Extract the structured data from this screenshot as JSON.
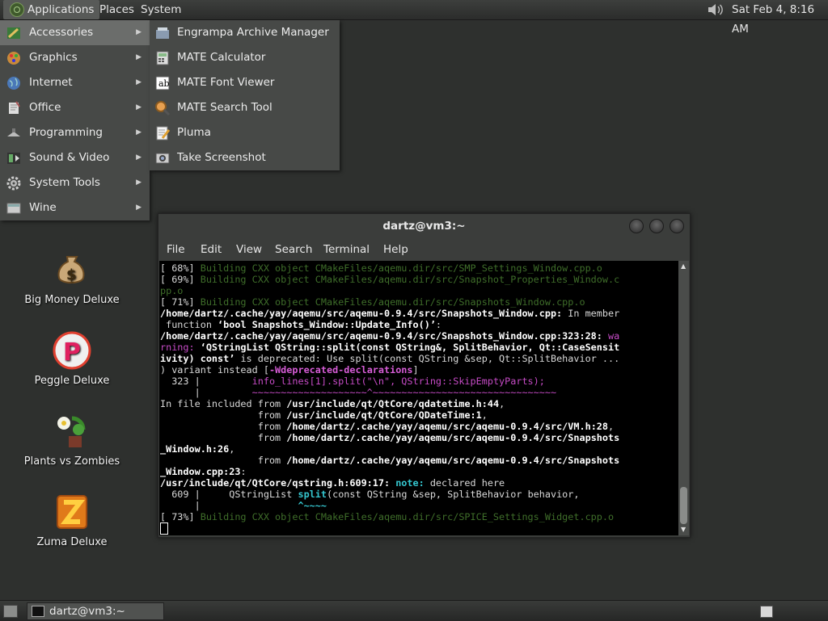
{
  "top_panel": {
    "applications": "Applications",
    "places": "Places",
    "system": "System",
    "volume_icon": "speaker-icon",
    "clock": "Sat Feb  4,  8:16 AM"
  },
  "app_menu": {
    "items": [
      {
        "label": "Accessories",
        "icon": "accessories-icon"
      },
      {
        "label": "Graphics",
        "icon": "graphics-icon"
      },
      {
        "label": "Internet",
        "icon": "globe-icon"
      },
      {
        "label": "Office",
        "icon": "office-icon"
      },
      {
        "label": "Programming",
        "icon": "programming-icon"
      },
      {
        "label": "Sound & Video",
        "icon": "sound-video-icon"
      },
      {
        "label": "System Tools",
        "icon": "gear-icon"
      },
      {
        "label": "Wine",
        "icon": "wine-icon"
      }
    ],
    "submenu": [
      {
        "label": "Engrampa Archive Manager",
        "icon": "archive-icon"
      },
      {
        "label": "MATE Calculator",
        "icon": "calculator-icon"
      },
      {
        "label": "MATE Font Viewer",
        "icon": "font-icon"
      },
      {
        "label": "MATE Search Tool",
        "icon": "search-icon"
      },
      {
        "label": "Pluma",
        "icon": "text-editor-icon"
      },
      {
        "label": "Take Screenshot",
        "icon": "screenshot-icon"
      }
    ]
  },
  "desktop_icons": [
    {
      "label": "Big Money Deluxe",
      "icon": "money-bag-icon"
    },
    {
      "label": "Peggle Deluxe",
      "icon": "peggle-icon"
    },
    {
      "label": "Plants vs Zombies",
      "icon": "plants-icon"
    },
    {
      "label": "Zuma Deluxe",
      "icon": "zuma-icon"
    }
  ],
  "terminal": {
    "title": "dartz@vm3:~",
    "menu": [
      "File",
      "Edit",
      "View",
      "Search",
      "Terminal",
      "Help"
    ],
    "lines": [
      [
        [
          "t",
          "[ 68%] "
        ],
        [
          "g",
          "Building CXX object CMakeFiles/aqemu.dir/src/SMP_Settings_Window.cpp.o"
        ]
      ],
      [
        [
          "t",
          "[ 69%] "
        ],
        [
          "g",
          "Building CXX object CMakeFiles/aqemu.dir/src/Snapshot_Properties_Window.c"
        ]
      ],
      [
        [
          "g",
          "pp.o"
        ]
      ],
      [
        [
          "t",
          "[ 71%] "
        ],
        [
          "g",
          "Building CXX object CMakeFiles/aqemu.dir/src/Snapshots_Window.cpp.o"
        ]
      ],
      [
        [
          "w",
          "/home/dartz/.cache/yay/aqemu/src/aqemu-0.9.4/src/Snapshots_Window.cpp:"
        ],
        [
          "t",
          " In member"
        ]
      ],
      [
        [
          "t",
          " function "
        ],
        [
          "w",
          "‘bool Snapshots_Window::Update_Info()’"
        ],
        [
          "t",
          ":"
        ]
      ],
      [
        [
          "w",
          "/home/dartz/.cache/yay/aqemu/src/aqemu-0.9.4/src/Snapshots_Window.cpp:323:28:"
        ],
        [
          "m",
          " wa"
        ]
      ],
      [
        [
          "m",
          "rning: "
        ],
        [
          "w",
          "‘QStringList QString::split(const QString&, SplitBehavior, Qt::CaseSensit"
        ]
      ],
      [
        [
          "w",
          "ivity) const’"
        ],
        [
          "t",
          " is deprecated: Use split(const QString &sep, Qt::SplitBehavior ..."
        ]
      ],
      [
        [
          "t",
          ") variant instead ["
        ],
        [
          "mb",
          "-Wdeprecated-declarations"
        ],
        [
          "t",
          "]"
        ]
      ],
      [
        [
          "t",
          "  323 |         "
        ],
        [
          "m",
          "info_lines[1].split(\"\\n\", QString::SkipEmptyParts);"
        ]
      ],
      [
        [
          "t",
          "      |         "
        ],
        [
          "m",
          "~~~~~~~~~~~~~~~~~~~~^~~~~~~~~~~~~~~~~~~~~~~~~~~~~~~~~"
        ]
      ],
      [
        [
          "t",
          "In file included from "
        ],
        [
          "w",
          "/usr/include/qt/QtCore/qdatetime.h:44"
        ],
        [
          "t",
          ","
        ]
      ],
      [
        [
          "t",
          "                 from "
        ],
        [
          "w",
          "/usr/include/qt/QtCore/QDateTime:1"
        ],
        [
          "t",
          ","
        ]
      ],
      [
        [
          "t",
          "                 from "
        ],
        [
          "w",
          "/home/dartz/.cache/yay/aqemu/src/aqemu-0.9.4/src/VM.h:28"
        ],
        [
          "t",
          ","
        ]
      ],
      [
        [
          "t",
          "                 from "
        ],
        [
          "w",
          "/home/dartz/.cache/yay/aqemu/src/aqemu-0.9.4/src/Snapshots"
        ]
      ],
      [
        [
          "w",
          "_Window.h:26"
        ],
        [
          "t",
          ","
        ]
      ],
      [
        [
          "t",
          "                 from "
        ],
        [
          "w",
          "/home/dartz/.cache/yay/aqemu/src/aqemu-0.9.4/src/Snapshots"
        ]
      ],
      [
        [
          "w",
          "_Window.cpp:23"
        ],
        [
          "t",
          ":"
        ]
      ],
      [
        [
          "w",
          "/usr/include/qt/QtCore/qstring.h:609:17:"
        ],
        [
          "c",
          " note:"
        ],
        [
          "t",
          " declared here"
        ]
      ],
      [
        [
          "t",
          "  609 |     QStringList "
        ],
        [
          "c",
          "split"
        ],
        [
          "t",
          "(const QString &sep, SplitBehavior behavior,"
        ]
      ],
      [
        [
          "t",
          "      |                 "
        ],
        [
          "c",
          "^~~~~"
        ]
      ],
      [
        [
          "t",
          "[ 73%] "
        ],
        [
          "g",
          "Building CXX object CMakeFiles/aqemu.dir/src/SPICE_Settings_Widget.cpp.o"
        ]
      ]
    ]
  },
  "taskbar": {
    "window_button": "dartz@vm3:~"
  }
}
